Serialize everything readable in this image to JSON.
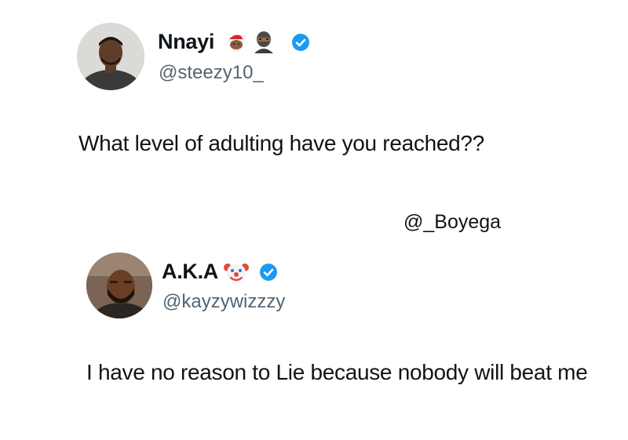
{
  "tweets": [
    {
      "display_name": "Nnayi",
      "handle": "@steezy10_",
      "verified": true,
      "name_emojis": [
        "santa-emoji",
        "ninja-emoji"
      ],
      "text": "What level of adulting have you reached??"
    },
    {
      "display_name": "A.K.A",
      "handle": "@kayzywizzzy",
      "verified": true,
      "name_emojis": [
        "clown-emoji"
      ],
      "text": "I have no reason to Lie because nobody will beat me"
    }
  ],
  "mention": "@_Boyega",
  "colors": {
    "text": "#0f1419",
    "secondary": "#536471",
    "verified": "#1d9bf0",
    "background": "#ffffff"
  }
}
